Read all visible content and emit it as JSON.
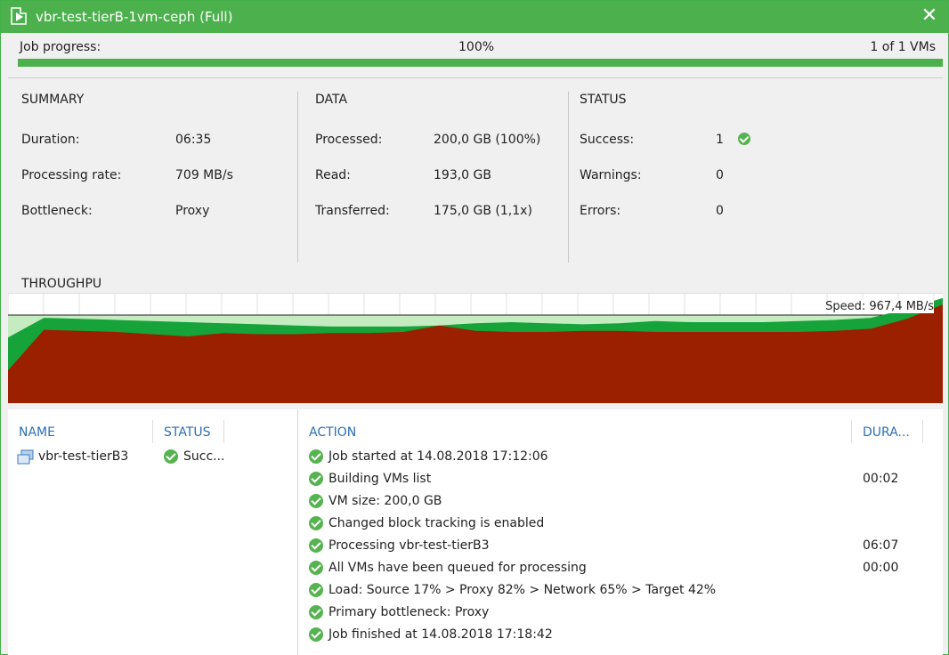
{
  "window": {
    "title": "vbr-test-tierB-1vm-ceph (Full)",
    "close_glyph": "✕"
  },
  "progress": {
    "label": "Job progress:",
    "percent_text": "100%",
    "value": 1.0,
    "vm_count_text": "1 of 1 VMs"
  },
  "summary": {
    "title": "SUMMARY",
    "items": [
      {
        "label": "Duration:",
        "value": "06:35"
      },
      {
        "label": "Processing rate:",
        "value": "709 MB/s"
      },
      {
        "label": "Bottleneck:",
        "value": "Proxy"
      }
    ]
  },
  "data_section": {
    "title": "DATA",
    "items": [
      {
        "label": "Processed:",
        "value": "200,0 GB (100%)"
      },
      {
        "label": "Read:",
        "value": "193,0 GB"
      },
      {
        "label": "Transferred:",
        "value": "175,0 GB (1,1x)"
      }
    ]
  },
  "status_section": {
    "title": "STATUS",
    "items": [
      {
        "label": "Success:",
        "value": "1",
        "icon": "success-icon"
      },
      {
        "label": "Warnings:",
        "value": "0"
      },
      {
        "label": "Errors:",
        "value": "0"
      }
    ]
  },
  "throughput": {
    "label": "THROUGHPU",
    "speed_text": "Speed: 967,4 MB/s"
  },
  "colors": {
    "accent_green": "#4cb14d",
    "read_green": "#16a33a",
    "light_green": "#c5ecc0",
    "transfer_red": "#9b2000",
    "header_blue": "#2b6fb5"
  },
  "chart_data": {
    "type": "area",
    "x": [
      0,
      1,
      2,
      3,
      4,
      5,
      6,
      7,
      8,
      9,
      10,
      11,
      12,
      13,
      14,
      15,
      16,
      17,
      18,
      19,
      20,
      21,
      22,
      23,
      24,
      25,
      26
    ],
    "series": [
      {
        "values": [
          0.6,
          0.78,
          0.77,
          0.76,
          0.75,
          0.74,
          0.73,
          0.72,
          0.71,
          0.7,
          0.7,
          0.7,
          0.71,
          0.73,
          0.74,
          0.73,
          0.72,
          0.73,
          0.75,
          0.74,
          0.74,
          0.74,
          0.75,
          0.76,
          0.78,
          0.86,
          0.96
        ]
      },
      {
        "values": [
          0.3,
          0.67,
          0.66,
          0.65,
          0.63,
          0.61,
          0.64,
          0.63,
          0.63,
          0.64,
          0.64,
          0.65,
          0.71,
          0.66,
          0.65,
          0.65,
          0.66,
          0.66,
          0.65,
          0.65,
          0.65,
          0.65,
          0.65,
          0.66,
          0.68,
          0.77,
          0.9
        ]
      }
    ],
    "ylim": [
      0,
      1
    ]
  },
  "vm_table": {
    "headers": {
      "name": "NAME",
      "status": "STATUS"
    },
    "rows": [
      {
        "name": "vbr-test-tierB3",
        "status": "Succ..."
      }
    ]
  },
  "action_table": {
    "headers": {
      "action": "ACTION",
      "duration": "DURA..."
    },
    "rows": [
      {
        "action": "Job started at 14.08.2018 17:12:06",
        "duration": ""
      },
      {
        "action": "Building VMs list",
        "duration": "00:02"
      },
      {
        "action": "VM size: 200,0 GB",
        "duration": ""
      },
      {
        "action": "Changed block tracking is enabled",
        "duration": ""
      },
      {
        "action": "Processing vbr-test-tierB3",
        "duration": "06:07"
      },
      {
        "action": "All VMs have been queued for processing",
        "duration": "00:00"
      },
      {
        "action": "Load: Source 17% > Proxy 82% > Network 65% > Target 42%",
        "duration": ""
      },
      {
        "action": "Primary bottleneck: Proxy",
        "duration": ""
      },
      {
        "action": "Job finished at 14.08.2018 17:18:42",
        "duration": ""
      }
    ]
  }
}
